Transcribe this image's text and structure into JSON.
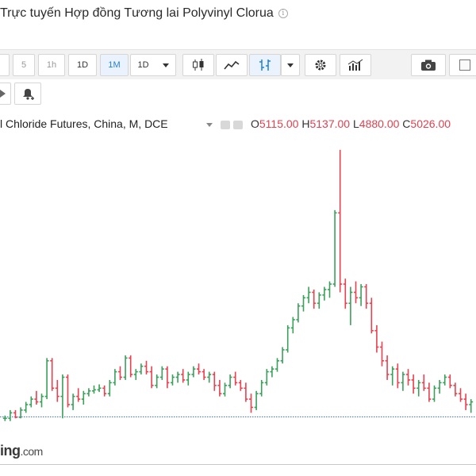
{
  "header": {
    "title": "Trực tuyến Hợp đồng Tương lai Polyvinyl Clorua",
    "info_icon": "info-icon"
  },
  "toolbar": {
    "intervals": [
      {
        "label": "5",
        "active": false,
        "grey": true
      },
      {
        "label": "1h",
        "active": false,
        "grey": true
      },
      {
        "label": "1D",
        "active": false,
        "grey": false
      },
      {
        "label": "1M",
        "active": true,
        "grey": false
      }
    ],
    "interval_dropdown": "1D",
    "icons": [
      "candlestick-chart-icon",
      "area-chart-icon",
      "bar-chart-icon",
      "chevron-down-icon",
      "gear-icon",
      "indicators-icon",
      "camera-icon",
      "fullscreen-icon"
    ]
  },
  "toolbar2": {
    "icons": [
      "play-icon",
      "alert-add-icon"
    ]
  },
  "legend": {
    "symbol": "l Chloride Futures, China, M, DCE",
    "open_label": "O",
    "open": "5115.00",
    "high_label": "H",
    "high": "5137.00",
    "low_label": "L",
    "low": "4880.00",
    "close_label": "C",
    "close": "5026.00"
  },
  "watermark": {
    "text": "ing",
    "suffix": ".com"
  },
  "chart_data": {
    "type": "bar",
    "style": "ohlc",
    "up_color": "#3aa05a",
    "down_color": "#e8414f",
    "last_price_line": "5026.00",
    "grid": false,
    "ohlc": [
      [
        5000,
        5050,
        4950,
        5000
      ],
      [
        5000,
        5150,
        4950,
        5100
      ],
      [
        5100,
        5150,
        5000,
        5020
      ],
      [
        5020,
        5200,
        5000,
        5150
      ],
      [
        5150,
        5300,
        5100,
        5250
      ],
      [
        5250,
        5400,
        5200,
        5350
      ],
      [
        5350,
        5500,
        5250,
        5300
      ],
      [
        5300,
        5450,
        5200,
        5400
      ],
      [
        5400,
        6100,
        5350,
        6050
      ],
      [
        6050,
        6100,
        5500,
        5550
      ],
      [
        5550,
        5700,
        5300,
        5400
      ],
      [
        5400,
        5800,
        5000,
        5750
      ],
      [
        5750,
        5800,
        5200,
        5250
      ],
      [
        5250,
        5450,
        5150,
        5400
      ],
      [
        5400,
        5550,
        5300,
        5350
      ],
      [
        5350,
        5500,
        5250,
        5450
      ],
      [
        5450,
        5550,
        5400,
        5500
      ],
      [
        5500,
        5600,
        5450,
        5520
      ],
      [
        5520,
        5620,
        5480,
        5550
      ],
      [
        5550,
        5600,
        5400,
        5450
      ],
      [
        5450,
        5700,
        5400,
        5650
      ],
      [
        5650,
        5900,
        5600,
        5850
      ],
      [
        5850,
        5950,
        5700,
        5750
      ],
      [
        5750,
        6150,
        5700,
        6100
      ],
      [
        6100,
        6150,
        5750,
        5800
      ],
      [
        5800,
        5900,
        5700,
        5850
      ],
      [
        5850,
        6000,
        5800,
        5950
      ],
      [
        5950,
        6050,
        5800,
        5850
      ],
      [
        5850,
        5950,
        5550,
        5600
      ],
      [
        5600,
        5800,
        5550,
        5750
      ],
      [
        5750,
        5950,
        5700,
        5900
      ],
      [
        5900,
        5950,
        5550,
        5650
      ],
      [
        5650,
        5800,
        5600,
        5750
      ],
      [
        5750,
        5850,
        5650,
        5800
      ],
      [
        5800,
        5900,
        5650,
        5700
      ],
      [
        5700,
        5850,
        5600,
        5800
      ],
      [
        5800,
        5950,
        5750,
        5900
      ],
      [
        5900,
        6000,
        5800,
        5850
      ],
      [
        5850,
        5900,
        5700,
        5750
      ],
      [
        5750,
        5850,
        5650,
        5800
      ],
      [
        5800,
        5850,
        5500,
        5600
      ],
      [
        5600,
        5700,
        5400,
        5450
      ],
      [
        5450,
        5650,
        5400,
        5600
      ],
      [
        5600,
        5800,
        5550,
        5750
      ],
      [
        5750,
        5850,
        5600,
        5650
      ],
      [
        5650,
        5700,
        5500,
        5550
      ],
      [
        5550,
        5650,
        5300,
        5350
      ],
      [
        5350,
        5450,
        5100,
        5200
      ],
      [
        5200,
        5500,
        5150,
        5450
      ],
      [
        5450,
        5700,
        5400,
        5650
      ],
      [
        5650,
        5900,
        5600,
        5850
      ],
      [
        5850,
        5950,
        5750,
        5900
      ],
      [
        5900,
        6100,
        5850,
        6050
      ],
      [
        6050,
        6300,
        6000,
        6250
      ],
      [
        6250,
        6700,
        6200,
        6650
      ],
      [
        6650,
        6850,
        6550,
        6800
      ],
      [
        6800,
        7100,
        6750,
        7050
      ],
      [
        7050,
        7250,
        6950,
        7200
      ],
      [
        7200,
        7400,
        7100,
        7300
      ],
      [
        7300,
        7350,
        7000,
        7100
      ],
      [
        7100,
        7300,
        7000,
        7250
      ],
      [
        7250,
        7400,
        7150,
        7350
      ],
      [
        7350,
        7500,
        7200,
        7450
      ],
      [
        7450,
        8800,
        7400,
        8750
      ],
      [
        8750,
        9900,
        7300,
        7450
      ],
      [
        7450,
        7550,
        7000,
        7100
      ],
      [
        7100,
        7400,
        6700,
        7300
      ],
      [
        7300,
        7500,
        7100,
        7200
      ],
      [
        7200,
        7450,
        7050,
        7400
      ],
      [
        7400,
        7450,
        7000,
        7100
      ],
      [
        7100,
        7200,
        6550,
        6600
      ],
      [
        6600,
        6700,
        6200,
        6300
      ],
      [
        6300,
        6400,
        5950,
        6050
      ],
      [
        6050,
        6150,
        5700,
        5800
      ],
      [
        5800,
        5950,
        5600,
        5900
      ],
      [
        5900,
        6000,
        5550,
        5650
      ],
      [
        5650,
        5850,
        5500,
        5800
      ],
      [
        5800,
        5900,
        5600,
        5700
      ],
      [
        5700,
        5800,
        5450,
        5550
      ],
      [
        5550,
        5700,
        5400,
        5650
      ],
      [
        5650,
        5800,
        5500,
        5550
      ],
      [
        5550,
        5650,
        5300,
        5350
      ],
      [
        5350,
        5600,
        5300,
        5550
      ],
      [
        5550,
        5700,
        5450,
        5650
      ],
      [
        5650,
        5800,
        5600,
        5750
      ],
      [
        5750,
        5800,
        5550,
        5600
      ],
      [
        5600,
        5650,
        5400,
        5450
      ],
      [
        5450,
        5550,
        5300,
        5350
      ],
      [
        5350,
        5450,
        5150,
        5250
      ],
      [
        5250,
        5350,
        5100,
        5300
      ]
    ]
  }
}
